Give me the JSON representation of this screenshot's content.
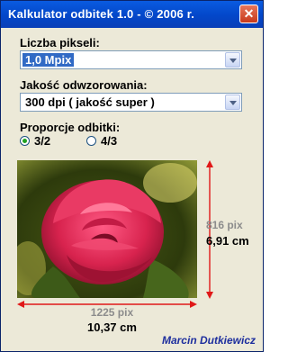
{
  "window": {
    "title": "Kalkulator odbitek 1.0  -  © 2006 r.",
    "close_glyph": "✕"
  },
  "pixels": {
    "label": "Liczba pikseli:",
    "selected": "1,0 Mpix"
  },
  "quality": {
    "label": "Jakość odwzorowania:",
    "selected": "300 dpi  ( jakość super )"
  },
  "ratio": {
    "label": "Proporcje odbitki:",
    "options": [
      "3/2",
      "4/3"
    ],
    "selected_index": 0
  },
  "image": {
    "icon": "rose-photo"
  },
  "width": {
    "px": "1225 pix",
    "cm": "10,37 cm"
  },
  "height": {
    "px": "816 pix",
    "cm": "6,91 cm"
  },
  "footer": {
    "author": "Marcin Dutkiewicz"
  },
  "colors": {
    "titlebar": "#0347c9",
    "dimension_arrow": "#e01818",
    "author": "#1e2f9e"
  }
}
